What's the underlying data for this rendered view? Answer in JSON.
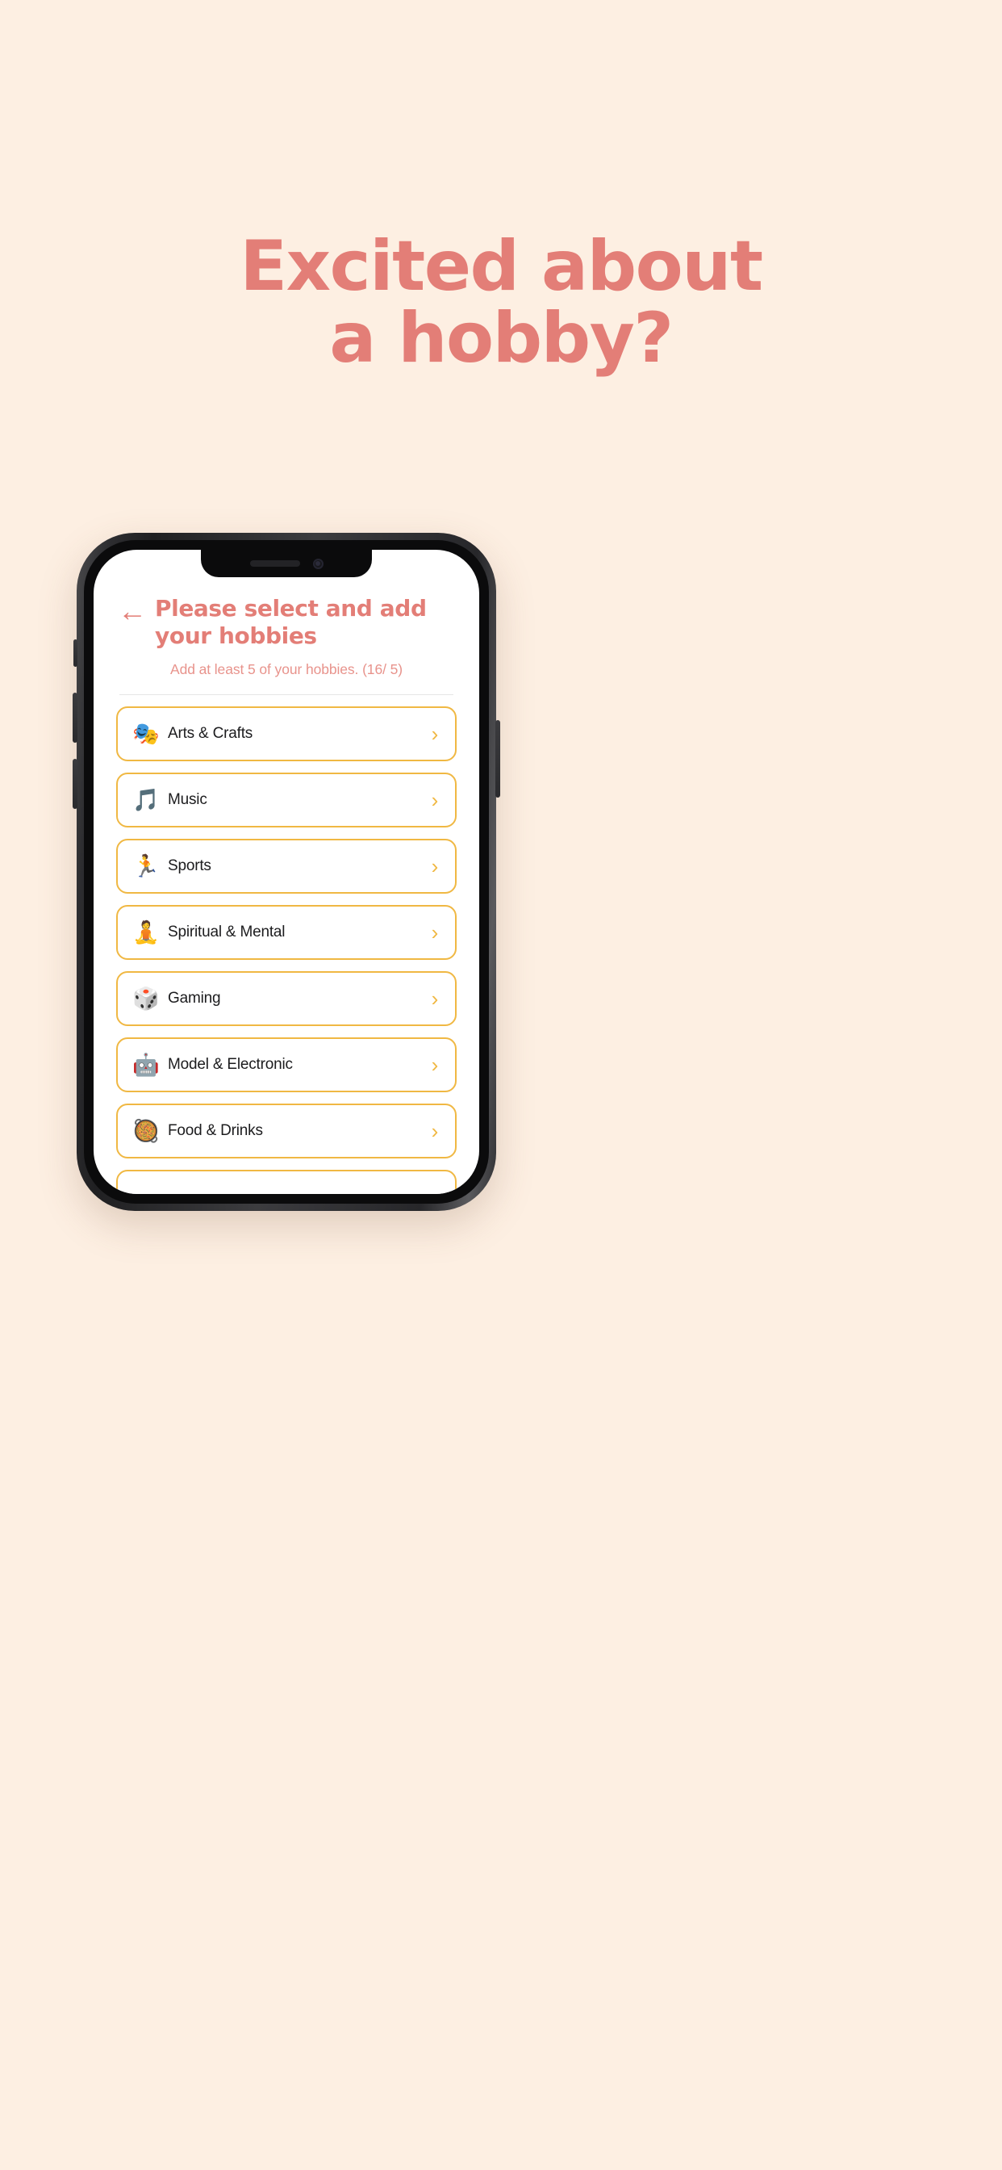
{
  "promo": {
    "headline_line1": "Excited about",
    "headline_line2": "a hobby?",
    "headline_color": "#E37E77",
    "background_color": "#FDEFE2"
  },
  "phone": {
    "notch": {
      "speaker": "speaker-slot",
      "camera": "front-camera"
    }
  },
  "screen": {
    "header": {
      "back_icon": "←",
      "title": "Please select and add your hobbies",
      "subtitle": "Add at least 5 of your hobbies. (16/ 5)",
      "selected_count": 16,
      "required_count": 5,
      "title_color": "#E37E77",
      "subtitle_color": "#E8938C"
    },
    "list": {
      "card_border_color": "#F0B843",
      "chevron_icon": "›",
      "items": [
        {
          "emoji": "🎭",
          "icon_name": "theater-masks-icon",
          "label": "Arts & Crafts"
        },
        {
          "emoji": "🎵",
          "icon_name": "music-note-icon",
          "label": "Music"
        },
        {
          "emoji": "🏃",
          "icon_name": "runner-icon",
          "label": "Sports"
        },
        {
          "emoji": "🧘",
          "icon_name": "lotus-position-icon",
          "label": "Spiritual & Mental"
        },
        {
          "emoji": "🎲",
          "icon_name": "dice-icon",
          "label": "Gaming"
        },
        {
          "emoji": "🤖",
          "icon_name": "robot-icon",
          "label": "Model & Electronic"
        },
        {
          "emoji": "🥘",
          "icon_name": "paella-icon",
          "label": "Food & Drinks"
        },
        {
          "emoji": "",
          "icon_name": "partial-card-icon",
          "label": ""
        }
      ]
    }
  }
}
